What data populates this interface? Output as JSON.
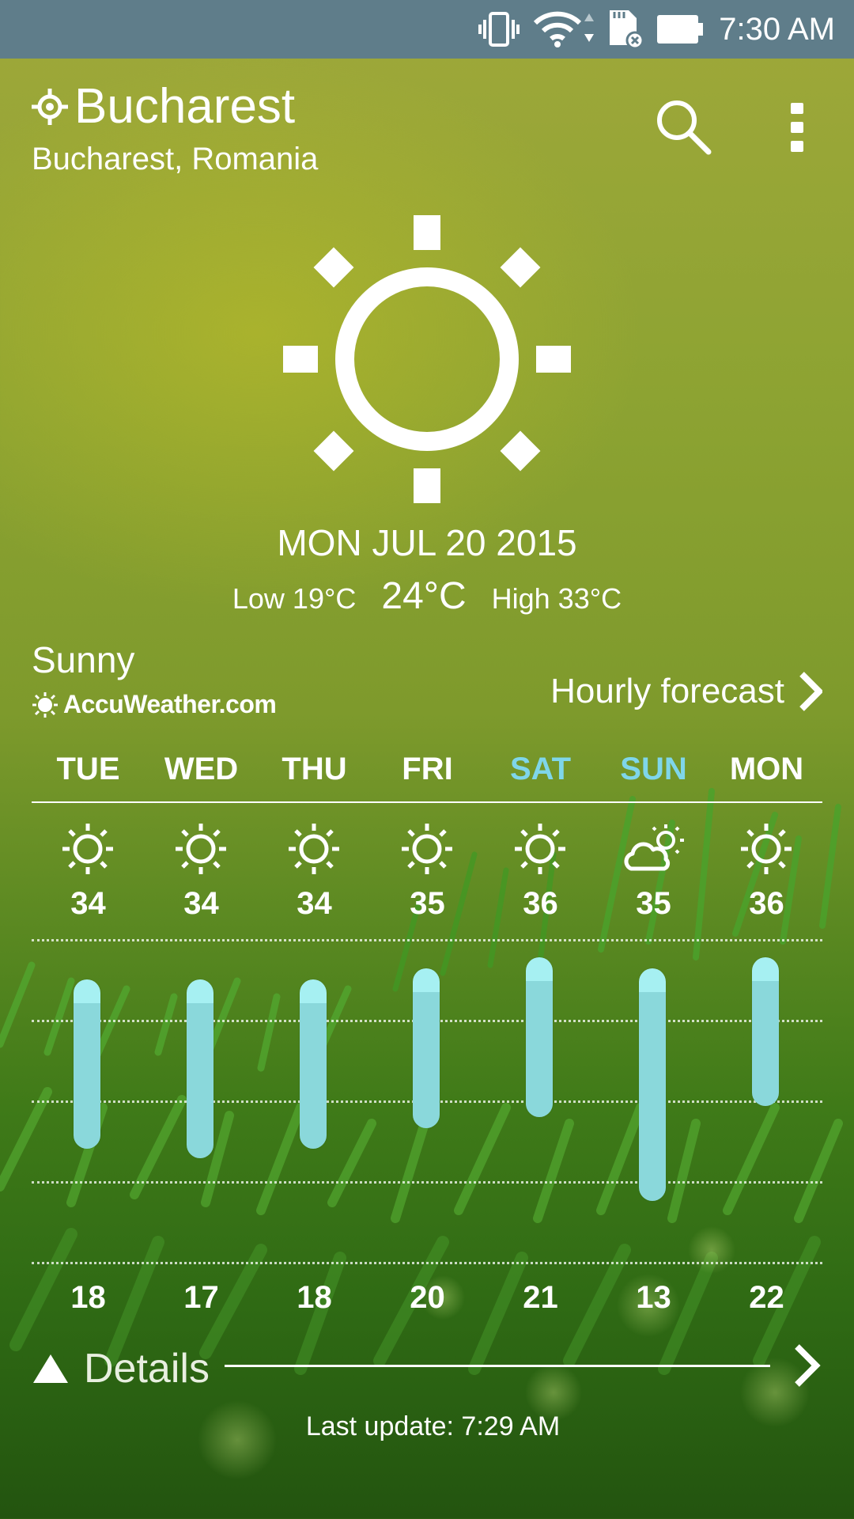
{
  "status_bar": {
    "time": "7:30 AM",
    "icons": [
      "vibrate-icon",
      "wifi-icon",
      "sd-card-error-icon",
      "battery-icon"
    ]
  },
  "header": {
    "city": "Bucharest",
    "region": "Bucharest, Romania",
    "actions": [
      "search-icon",
      "more-vert-icon"
    ]
  },
  "current": {
    "icon": "sun-icon",
    "date": "MON JUL 20 2015",
    "low": "Low 19°C",
    "temp": "24°C",
    "high": "High 33°C",
    "condition": "Sunny",
    "provider": "AccuWeather.com",
    "hourly_label": "Hourly forecast"
  },
  "forecast": [
    {
      "day": "TUE",
      "icon": "sun-icon",
      "high": "34",
      "low": "18",
      "weekend": false
    },
    {
      "day": "WED",
      "icon": "sun-icon",
      "high": "34",
      "low": "17",
      "weekend": false
    },
    {
      "day": "THU",
      "icon": "sun-icon",
      "high": "34",
      "low": "18",
      "weekend": false
    },
    {
      "day": "FRI",
      "icon": "sun-icon",
      "high": "35",
      "low": "20",
      "weekend": false
    },
    {
      "day": "SAT",
      "icon": "sun-icon",
      "high": "36",
      "low": "21",
      "weekend": true
    },
    {
      "day": "SUN",
      "icon": "partly-cloudy-icon",
      "high": "35",
      "low": "13",
      "weekend": true
    },
    {
      "day": "MON",
      "icon": "sun-icon",
      "high": "36",
      "low": "22",
      "weekend": false
    }
  ],
  "details": {
    "label": "Details",
    "last_update": "Last update: 7:29 AM"
  },
  "colors": {
    "status_bar": "#5f7d8a",
    "weekend_day": "#7fd6ea",
    "bar": "#8ad8db",
    "bar_cap": "#a6f0f2"
  }
}
